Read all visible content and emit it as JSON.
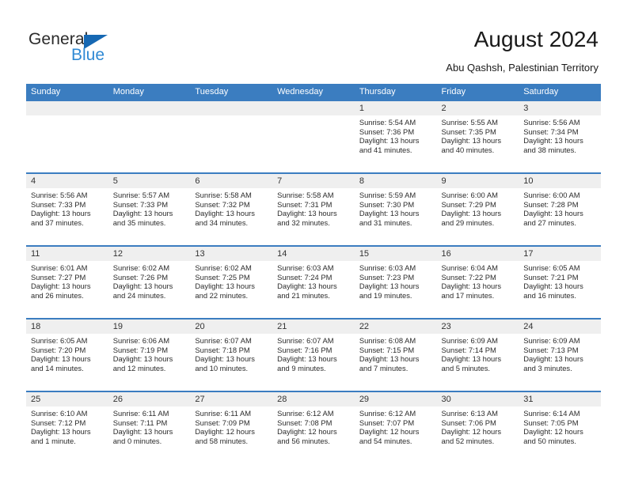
{
  "brand": {
    "name_dark": "General",
    "name_blue": "Blue",
    "accent_color": "#2f89d4",
    "triangle_color": "#1668b3"
  },
  "header": {
    "title": "August 2024",
    "subtitle": "Abu Qashsh, Palestinian Territory"
  },
  "calendar": {
    "header_bg": "#3b7dc0",
    "header_text_color": "#ffffff",
    "daynum_band_bg": "#efefef",
    "weekday_headers": [
      "Sunday",
      "Monday",
      "Tuesday",
      "Wednesday",
      "Thursday",
      "Friday",
      "Saturday"
    ],
    "weeks": [
      [
        {
          "day": "",
          "lines": []
        },
        {
          "day": "",
          "lines": []
        },
        {
          "day": "",
          "lines": []
        },
        {
          "day": "",
          "lines": []
        },
        {
          "day": "1",
          "lines": [
            "Sunrise: 5:54 AM",
            "Sunset: 7:36 PM",
            "Daylight: 13 hours",
            "and 41 minutes."
          ]
        },
        {
          "day": "2",
          "lines": [
            "Sunrise: 5:55 AM",
            "Sunset: 7:35 PM",
            "Daylight: 13 hours",
            "and 40 minutes."
          ]
        },
        {
          "day": "3",
          "lines": [
            "Sunrise: 5:56 AM",
            "Sunset: 7:34 PM",
            "Daylight: 13 hours",
            "and 38 minutes."
          ]
        }
      ],
      [
        {
          "day": "4",
          "lines": [
            "Sunrise: 5:56 AM",
            "Sunset: 7:33 PM",
            "Daylight: 13 hours",
            "and 37 minutes."
          ]
        },
        {
          "day": "5",
          "lines": [
            "Sunrise: 5:57 AM",
            "Sunset: 7:33 PM",
            "Daylight: 13 hours",
            "and 35 minutes."
          ]
        },
        {
          "day": "6",
          "lines": [
            "Sunrise: 5:58 AM",
            "Sunset: 7:32 PM",
            "Daylight: 13 hours",
            "and 34 minutes."
          ]
        },
        {
          "day": "7",
          "lines": [
            "Sunrise: 5:58 AM",
            "Sunset: 7:31 PM",
            "Daylight: 13 hours",
            "and 32 minutes."
          ]
        },
        {
          "day": "8",
          "lines": [
            "Sunrise: 5:59 AM",
            "Sunset: 7:30 PM",
            "Daylight: 13 hours",
            "and 31 minutes."
          ]
        },
        {
          "day": "9",
          "lines": [
            "Sunrise: 6:00 AM",
            "Sunset: 7:29 PM",
            "Daylight: 13 hours",
            "and 29 minutes."
          ]
        },
        {
          "day": "10",
          "lines": [
            "Sunrise: 6:00 AM",
            "Sunset: 7:28 PM",
            "Daylight: 13 hours",
            "and 27 minutes."
          ]
        }
      ],
      [
        {
          "day": "11",
          "lines": [
            "Sunrise: 6:01 AM",
            "Sunset: 7:27 PM",
            "Daylight: 13 hours",
            "and 26 minutes."
          ]
        },
        {
          "day": "12",
          "lines": [
            "Sunrise: 6:02 AM",
            "Sunset: 7:26 PM",
            "Daylight: 13 hours",
            "and 24 minutes."
          ]
        },
        {
          "day": "13",
          "lines": [
            "Sunrise: 6:02 AM",
            "Sunset: 7:25 PM",
            "Daylight: 13 hours",
            "and 22 minutes."
          ]
        },
        {
          "day": "14",
          "lines": [
            "Sunrise: 6:03 AM",
            "Sunset: 7:24 PM",
            "Daylight: 13 hours",
            "and 21 minutes."
          ]
        },
        {
          "day": "15",
          "lines": [
            "Sunrise: 6:03 AM",
            "Sunset: 7:23 PM",
            "Daylight: 13 hours",
            "and 19 minutes."
          ]
        },
        {
          "day": "16",
          "lines": [
            "Sunrise: 6:04 AM",
            "Sunset: 7:22 PM",
            "Daylight: 13 hours",
            "and 17 minutes."
          ]
        },
        {
          "day": "17",
          "lines": [
            "Sunrise: 6:05 AM",
            "Sunset: 7:21 PM",
            "Daylight: 13 hours",
            "and 16 minutes."
          ]
        }
      ],
      [
        {
          "day": "18",
          "lines": [
            "Sunrise: 6:05 AM",
            "Sunset: 7:20 PM",
            "Daylight: 13 hours",
            "and 14 minutes."
          ]
        },
        {
          "day": "19",
          "lines": [
            "Sunrise: 6:06 AM",
            "Sunset: 7:19 PM",
            "Daylight: 13 hours",
            "and 12 minutes."
          ]
        },
        {
          "day": "20",
          "lines": [
            "Sunrise: 6:07 AM",
            "Sunset: 7:18 PM",
            "Daylight: 13 hours",
            "and 10 minutes."
          ]
        },
        {
          "day": "21",
          "lines": [
            "Sunrise: 6:07 AM",
            "Sunset: 7:16 PM",
            "Daylight: 13 hours",
            "and 9 minutes."
          ]
        },
        {
          "day": "22",
          "lines": [
            "Sunrise: 6:08 AM",
            "Sunset: 7:15 PM",
            "Daylight: 13 hours",
            "and 7 minutes."
          ]
        },
        {
          "day": "23",
          "lines": [
            "Sunrise: 6:09 AM",
            "Sunset: 7:14 PM",
            "Daylight: 13 hours",
            "and 5 minutes."
          ]
        },
        {
          "day": "24",
          "lines": [
            "Sunrise: 6:09 AM",
            "Sunset: 7:13 PM",
            "Daylight: 13 hours",
            "and 3 minutes."
          ]
        }
      ],
      [
        {
          "day": "25",
          "lines": [
            "Sunrise: 6:10 AM",
            "Sunset: 7:12 PM",
            "Daylight: 13 hours",
            "and 1 minute."
          ]
        },
        {
          "day": "26",
          "lines": [
            "Sunrise: 6:11 AM",
            "Sunset: 7:11 PM",
            "Daylight: 13 hours",
            "and 0 minutes."
          ]
        },
        {
          "day": "27",
          "lines": [
            "Sunrise: 6:11 AM",
            "Sunset: 7:09 PM",
            "Daylight: 12 hours",
            "and 58 minutes."
          ]
        },
        {
          "day": "28",
          "lines": [
            "Sunrise: 6:12 AM",
            "Sunset: 7:08 PM",
            "Daylight: 12 hours",
            "and 56 minutes."
          ]
        },
        {
          "day": "29",
          "lines": [
            "Sunrise: 6:12 AM",
            "Sunset: 7:07 PM",
            "Daylight: 12 hours",
            "and 54 minutes."
          ]
        },
        {
          "day": "30",
          "lines": [
            "Sunrise: 6:13 AM",
            "Sunset: 7:06 PM",
            "Daylight: 12 hours",
            "and 52 minutes."
          ]
        },
        {
          "day": "31",
          "lines": [
            "Sunrise: 6:14 AM",
            "Sunset: 7:05 PM",
            "Daylight: 12 hours",
            "and 50 minutes."
          ]
        }
      ]
    ]
  }
}
